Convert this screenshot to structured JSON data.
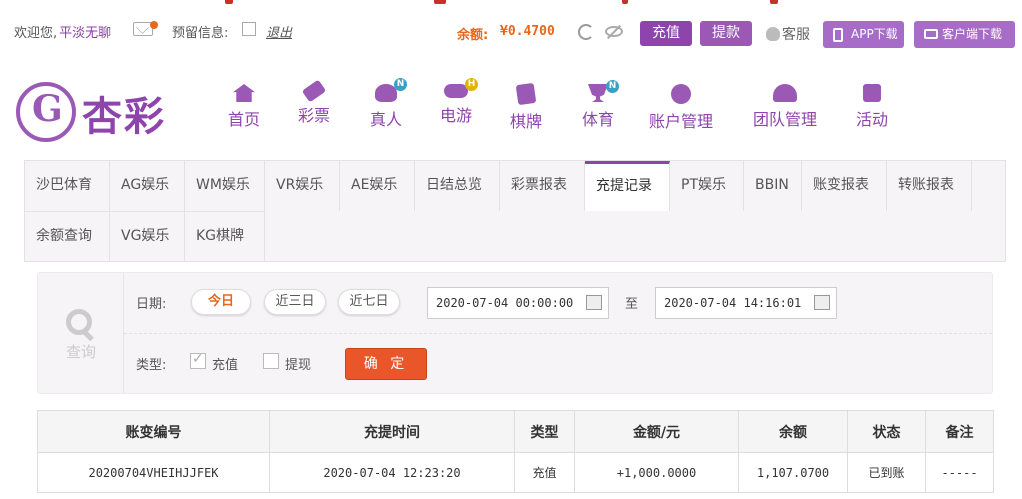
{
  "topbar": {
    "welcome_prefix": "欢迎您,",
    "username": "平淡无聊",
    "reserve_label": "预留信息:",
    "logout_label": "退出",
    "balance_label": "余额:",
    "balance_value": "¥0.4700",
    "recharge_label": "充值",
    "withdraw_label": "提款",
    "service_label": "客服",
    "app_download_label": "APP下载",
    "client_download_label": "客户端下载",
    "accent": "#8e44ad",
    "balance_color": "#e8671a"
  },
  "logo": {
    "mark": "G",
    "text": "杏彩"
  },
  "nav": {
    "items": [
      {
        "label": "首页",
        "icon": "home-icon"
      },
      {
        "label": "彩票",
        "icon": "ticket-icon"
      },
      {
        "label": "真人",
        "icon": "dealer-icon",
        "badge": "N"
      },
      {
        "label": "电游",
        "icon": "gamepad-icon",
        "badge": "H"
      },
      {
        "label": "棋牌",
        "icon": "cards-icon"
      },
      {
        "label": "体育",
        "icon": "trophy-icon",
        "badge": "N"
      },
      {
        "label": "账户管理",
        "icon": "yen-icon"
      },
      {
        "label": "团队管理",
        "icon": "team-icon"
      },
      {
        "label": "活动",
        "icon": "gift-icon"
      }
    ]
  },
  "tabs": [
    "沙巴体育",
    "AG娱乐",
    "WM娱乐",
    "VR娱乐",
    "AE娱乐",
    "日结总览",
    "彩票报表",
    "充提记录",
    "PT娱乐",
    "BBIN",
    "账变报表",
    "转账报表",
    "余额查询",
    "VG娱乐",
    "KG棋牌"
  ],
  "active_tab": "充提记录",
  "query": {
    "side_label": "查询",
    "date_label": "日期:",
    "range_today": "今日",
    "range_3days": "近三日",
    "range_7days": "近七日",
    "date_from": "2020-07-04 00:00:00",
    "to_label": "至",
    "date_to": "2020-07-04 14:16:01",
    "type_label": "类型:",
    "type_recharge": "充值",
    "type_recharge_checked": true,
    "type_withdraw": "提现",
    "type_withdraw_checked": false,
    "confirm_label": "确 定"
  },
  "table": {
    "headers": [
      "账变编号",
      "充提时间",
      "类型",
      "金额/元",
      "余额",
      "状态",
      "备注"
    ],
    "rows": [
      [
        "20200704VHEIHJJFEK",
        "2020-07-04 12:23:20",
        "充值",
        "+1,000.0000",
        "1,107.0700",
        "已到账",
        "-----"
      ]
    ]
  }
}
